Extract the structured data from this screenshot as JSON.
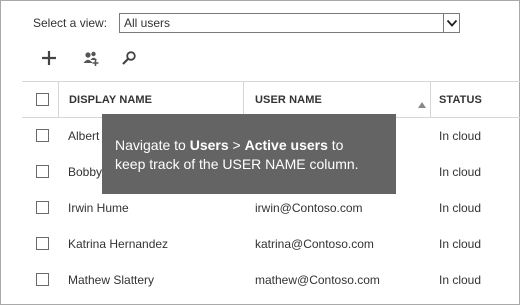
{
  "view_selector": {
    "label": "Select a view:",
    "value": "All users",
    "arrow_icon": "chevron-down-icon"
  },
  "toolbar": {
    "add_icon": "plus-icon",
    "add_users_icon": "add-users-icon",
    "search_icon": "search-icon"
  },
  "table": {
    "columns": {
      "display_name": "DISPLAY NAME",
      "user_name": "USER NAME",
      "status": "STATUS"
    },
    "sort": {
      "column": "USER NAME",
      "direction": "ascending",
      "icon": "sort-ascending-icon"
    },
    "rows": [
      {
        "display_name": "Albert",
        "user_name": "",
        "status": "In cloud"
      },
      {
        "display_name": "Bobby",
        "user_name": "",
        "status": "In cloud"
      },
      {
        "display_name": "Irwin Hume",
        "user_name": "irwin@Contoso.com",
        "status": "In cloud"
      },
      {
        "display_name": "Katrina Hernandez",
        "user_name": "katrina@Contoso.com",
        "status": "In cloud"
      },
      {
        "display_name": "Mathew Slattery",
        "user_name": "mathew@Contoso.com",
        "status": "In cloud"
      }
    ]
  },
  "tooltip": {
    "prefix": "Navigate to ",
    "users": "Users",
    "separator": " > ",
    "active_users": "Active users",
    "suffix_1": " to",
    "line_2": "keep track of the USER NAME column."
  },
  "colors": {
    "tooltip_bg": "#646464",
    "border": "#d6d6d6",
    "text": "#333333"
  }
}
